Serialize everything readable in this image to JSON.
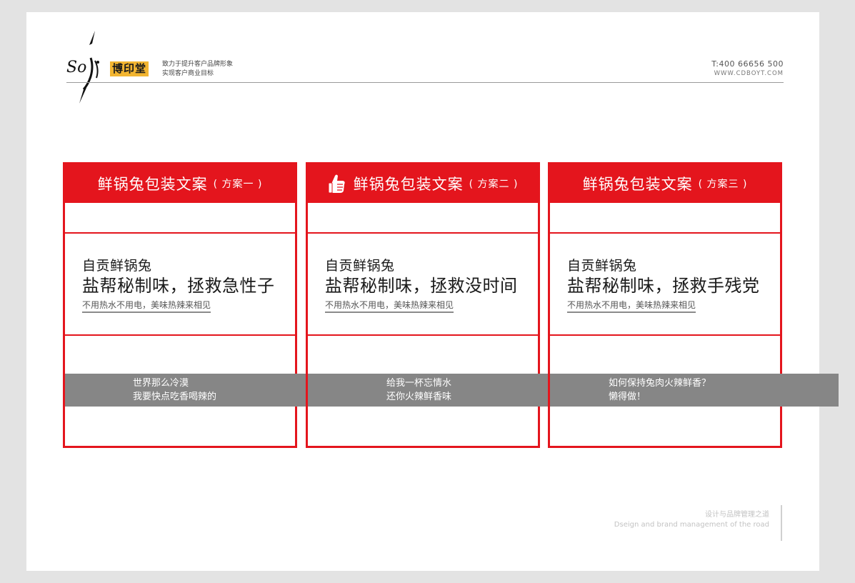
{
  "header": {
    "brand_name": "博印堂",
    "slogan_line1": "致力于提升客户品牌形象",
    "slogan_line2": "实现客户商业目标",
    "phone": "T:400 66656 500",
    "website": "WWW.CDBOYT.COM"
  },
  "cards": [
    {
      "title": "鲜锅兔包装文案",
      "plan": "( 方案一 )",
      "line1": "自贡鲜锅兔",
      "line2": "盐帮秘制味，拯救急性子",
      "line3": "不用热水不用电，美味热辣来相见",
      "band_line1": "世界那么冷漠",
      "band_line2": "我要快点吃香喝辣的"
    },
    {
      "title": "鲜锅兔包装文案",
      "plan": "( 方案二 )",
      "line1": "自贡鲜锅兔",
      "line2": "盐帮秘制味，拯救没时间",
      "line3": "不用热水不用电，美味热辣来相见",
      "band_line1": "给我一杯忘情水",
      "band_line2": "还你火辣鲜香味"
    },
    {
      "title": "鲜锅兔包装文案",
      "plan": "( 方案三 )",
      "line1": "自贡鲜锅兔",
      "line2": "盐帮秘制味，拯救手残党",
      "line3": "不用热水不用电，美味热辣来相见",
      "band_line1": "如何保持兔肉火辣鲜香？",
      "band_line2": "懒得做！"
    }
  ],
  "footer": {
    "cn": "设计与品牌管理之道",
    "en": "Dseign and brand management of the road"
  },
  "colors": {
    "accent": "#e4151d",
    "band": "#868686",
    "brand_badge": "#f2b531"
  }
}
